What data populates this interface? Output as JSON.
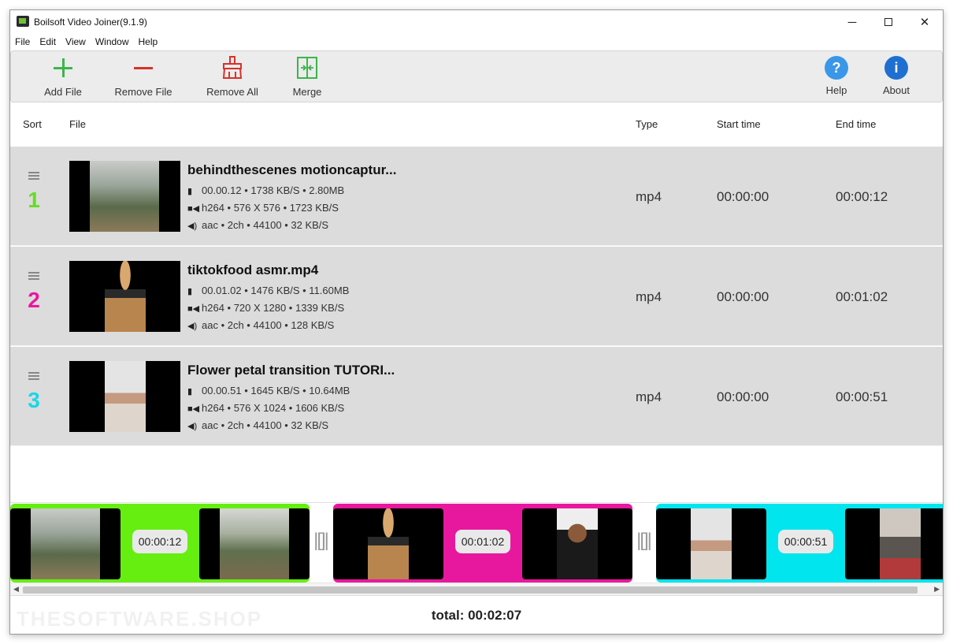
{
  "window": {
    "title": "Boilsoft Video Joiner(9.1.9)",
    "controls": {
      "minimize": "─",
      "close": "✕"
    }
  },
  "menu": [
    "File",
    "Edit",
    "View",
    "Window",
    "Help"
  ],
  "toolbar": {
    "add_file": "Add File",
    "remove_file": "Remove File",
    "remove_all": "Remove All",
    "merge": "Merge",
    "help": "Help",
    "about": "About",
    "help_glyph": "?",
    "about_glyph": "i"
  },
  "table": {
    "headers": {
      "sort": "Sort",
      "file": "File",
      "type": "Type",
      "start": "Start time",
      "end": "End time"
    },
    "rows": [
      {
        "index": "1",
        "color": "#66dd22",
        "name": "behindthescenes motioncaptur...",
        "file_info": "00.00.12 •  1738 KB/S • 2.80MB",
        "video_info": "h264 • 576 X 576 • 1723 KB/S",
        "audio_info": "aac • 2ch • 44100 • 32 KB/S",
        "type": "mp4",
        "start": "00:00:00",
        "end": "00:00:12"
      },
      {
        "index": "2",
        "color": "#e8189e",
        "name": "tiktokfood asmr.mp4",
        "file_info": "00.01.02 •  1476 KB/S • 11.60MB",
        "video_info": "h264 • 720 X 1280 • 1339 KB/S",
        "audio_info": "aac • 2ch • 44100 • 128 KB/S",
        "type": "mp4",
        "start": "00:00:00",
        "end": "00:01:02"
      },
      {
        "index": "3",
        "color": "#1ad6e6",
        "name": "Flower petal transition TUTORI...",
        "file_info": "00.00.51 •  1645 KB/S • 10.64MB",
        "video_info": "h264 • 576 X 1024 • 1606 KB/S",
        "audio_info": "aac • 2ch • 44100 • 32 KB/S",
        "type": "mp4",
        "start": "00:00:00",
        "end": "00:00:51"
      }
    ]
  },
  "timeline": {
    "clips": [
      {
        "duration": "00:00:12",
        "color": "#66ee11"
      },
      {
        "duration": "00:01:02",
        "color": "#e8189e"
      },
      {
        "duration": "00:00:51",
        "color": "#00e5ee"
      }
    ],
    "splitter_glyph": "|[]|"
  },
  "footer": {
    "total": "total: 00:02:07",
    "watermark": "THESOFTWARE.SHOP"
  },
  "icons": {
    "file": "file-icon",
    "video": "video-camera-icon",
    "audio": "speaker-icon"
  }
}
